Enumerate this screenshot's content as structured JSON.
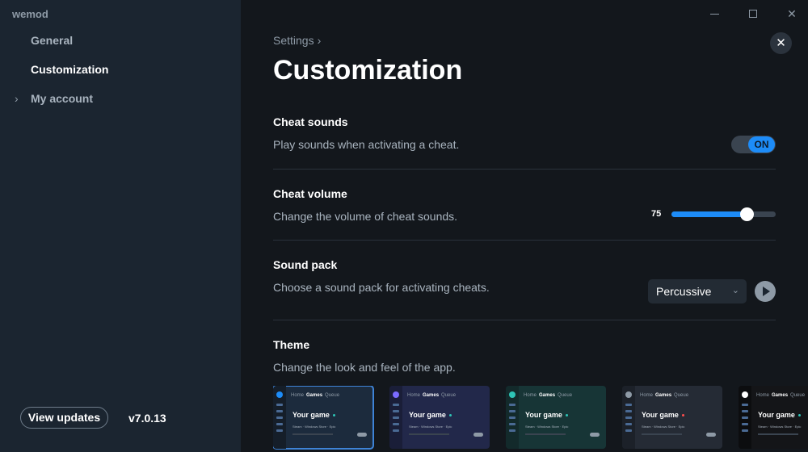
{
  "app": {
    "name": "wemod"
  },
  "sidebar": {
    "items": [
      {
        "label": "General"
      },
      {
        "label": "Customization"
      },
      {
        "label": "My account"
      }
    ],
    "view_updates_label": "View updates",
    "version": "v7.0.13"
  },
  "window_controls": {
    "minimize_icon": "minimize-icon",
    "maximize_icon": "maximize-icon",
    "close_icon": "close-icon"
  },
  "main": {
    "breadcrumb": "Settings",
    "title": "Customization",
    "close_symbol": "✕",
    "sections": {
      "cheat_sounds": {
        "title": "Cheat sounds",
        "description": "Play sounds when activating a cheat.",
        "toggle_label": "ON",
        "enabled": true
      },
      "cheat_volume": {
        "title": "Cheat volume",
        "description": "Change the volume of cheat sounds.",
        "value": "75",
        "level": 0.72
      },
      "sound_pack": {
        "title": "Sound pack",
        "description": "Choose a sound pack for activating cheats.",
        "selected": "Percussive"
      },
      "theme": {
        "title": "Theme",
        "description": "Change the look and feel of the app.",
        "preview": {
          "nav_home": "Home",
          "nav_games": "Games",
          "nav_queue": "Queue",
          "game": "Your game",
          "platforms": "Steam · Windows Store · Epic",
          "selected_index": 0
        },
        "options": [
          {
            "bg": "#1c2b3d",
            "side": "#151e29",
            "accent": "#1d8cf8",
            "dot": "#2ec4b6"
          },
          {
            "bg": "#22284a",
            "side": "#1a1e38",
            "accent": "#7b6cff",
            "dot": "#2ec4b6"
          },
          {
            "bg": "#173536",
            "side": "#132a2b",
            "accent": "#2ec4b6",
            "dot": "#2ec4b6"
          },
          {
            "bg": "#252b35",
            "side": "#1c2129",
            "accent": "#8e9aa6",
            "dot": "#ff4d4d"
          },
          {
            "bg": "#141518",
            "side": "#0c0d0f",
            "accent": "#ffffff",
            "dot": "#2ec4b6"
          }
        ]
      }
    }
  },
  "colors": {
    "accent": "#1d8cf8",
    "sidebar_bg": "#1b2530",
    "main_bg": "#13171c"
  }
}
